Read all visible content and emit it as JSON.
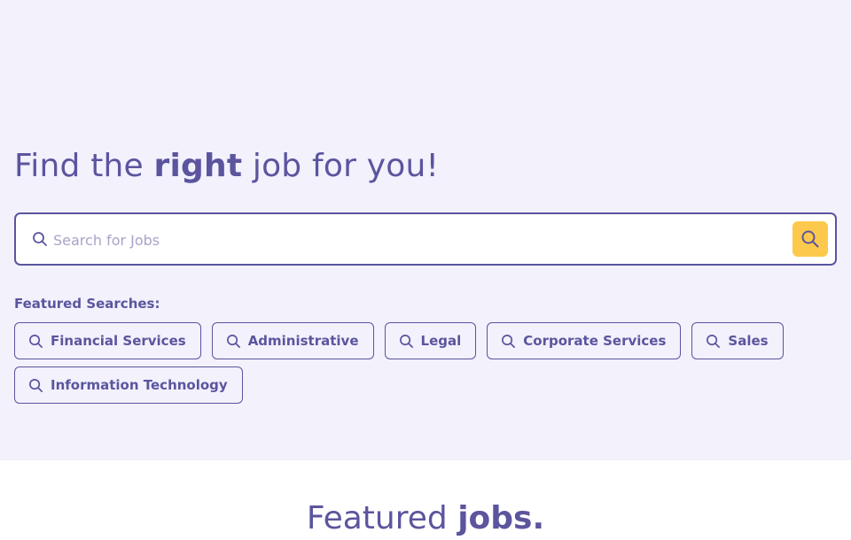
{
  "hero": {
    "headline_pre": "Find the ",
    "headline_emph": "right",
    "headline_post": " job for you!"
  },
  "search": {
    "placeholder": "Search for Jobs",
    "value": "",
    "icon": "search-icon",
    "button_icon": "search-icon"
  },
  "featured": {
    "label": "Featured Searches:",
    "items": [
      {
        "label": "Financial Services",
        "icon": "search-icon"
      },
      {
        "label": "Administrative",
        "icon": "search-icon"
      },
      {
        "label": "Legal",
        "icon": "search-icon"
      },
      {
        "label": "Corporate Services",
        "icon": "search-icon"
      },
      {
        "label": "Sales",
        "icon": "search-icon"
      },
      {
        "label": "Information Technology",
        "icon": "search-icon"
      }
    ]
  },
  "section": {
    "title_pre": "Featured ",
    "title_emph": "jobs."
  },
  "colors": {
    "primary": "#5b559e",
    "accent": "#fcc94c",
    "hero_bg": "#f2f1fc",
    "underline": "#f5c144"
  }
}
